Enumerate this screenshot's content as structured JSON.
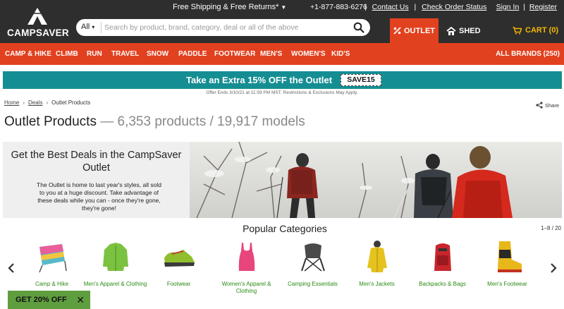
{
  "header": {
    "logo_text": "CAMPSAVER",
    "promo": "Free Shipping & Free Returns*",
    "phone": "+1-877-883-6276",
    "links": [
      "Contact Us",
      "Check Order Status"
    ],
    "account": [
      "Sign In",
      "Register"
    ],
    "search": {
      "category": "All",
      "placeholder": "Search by product, brand, category, deal or all of the above"
    },
    "outlet_tab": "OUTLET",
    "shed_tab": "SHED",
    "cart": "CART (0)"
  },
  "nav": {
    "items": [
      "CAMP & HIKE",
      "CLIMB",
      "RUN",
      "TRAVEL",
      "SNOW",
      "PADDLE",
      "FOOTWEAR",
      "MEN'S",
      "WOMEN'S",
      "KID'S"
    ],
    "brands": "ALL BRANDS (250)"
  },
  "banner": {
    "text": "Take an Extra 15% OFF the Outlet",
    "code": "SAVE15",
    "fine_print": "Offer Ends 3/10/21 at 11:59 PM MST. Restrictions & Exclusions May Apply."
  },
  "breadcrumb": [
    "Home",
    "Deals",
    "Outlet Products"
  ],
  "share_label": "Share",
  "page": {
    "title": "Outlet Products",
    "counts": "— 6,353 products / 19,917 models"
  },
  "hero": {
    "heading": "Get the Best Deals in the CampSaver Outlet",
    "body": "The Outlet is home to last year's styles, all sold to you at a huge discount. Take advantage of these deals while you can - once they're gone, they're gone!"
  },
  "categories": {
    "title": "Popular Categories",
    "pager": "1–8 / 20",
    "items": [
      {
        "label": "Camp & Hike",
        "icon": "camp-chair-icon"
      },
      {
        "label": "Men's Apparel & Clothing",
        "icon": "green-jacket-icon"
      },
      {
        "label": "Footwear",
        "icon": "trail-shoe-icon"
      },
      {
        "label": "Women's Apparel & Clothing",
        "icon": "pink-tank-top-icon"
      },
      {
        "label": "Camping Essentials",
        "icon": "camp-stool-icon"
      },
      {
        "label": "Men's Jackets",
        "icon": "yellow-jacket-icon"
      },
      {
        "label": "Backpacks & Bags",
        "icon": "red-backpack-icon"
      },
      {
        "label": "Men's Footwear",
        "icon": "mountaineering-boot-icon"
      }
    ]
  },
  "discount_popup": {
    "text": "GET 20% OFF",
    "close": "✕"
  },
  "colors": {
    "header_bg": "#2e2e2e",
    "accent_orange": "#e2411f",
    "banner_teal": "#158e93",
    "cart_yellow": "#f5b800",
    "category_green": "#2a8a14",
    "popup_green": "#5f9e3f"
  }
}
